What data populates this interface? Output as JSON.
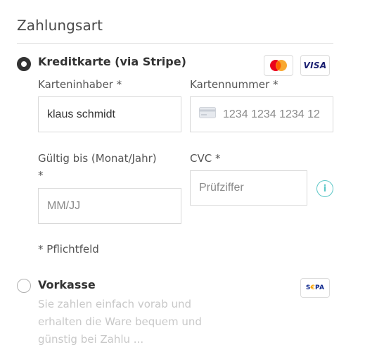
{
  "section_title": "Zahlungsart",
  "methods": {
    "credit_card": {
      "title": "Kreditkarte (via Stripe)",
      "selected": true,
      "badges": [
        "mastercard-icon",
        "visa-icon"
      ],
      "visa_label": "VISA",
      "fields": {
        "holder": {
          "label": "Karteninhaber *",
          "value": "klaus schmidt"
        },
        "number": {
          "label": "Kartennummer *",
          "placeholder": "1234 1234 1234 12"
        },
        "expiry": {
          "label_line1": "Gültig bis (Monat/Jahr)",
          "label_line2": "*",
          "placeholder": "MM/JJ"
        },
        "cvc": {
          "label": "CVC *",
          "placeholder": "Prüfziffer"
        }
      },
      "required_note": "* Pflichtfeld"
    },
    "prepayment": {
      "title": "Vorkasse",
      "selected": false,
      "sepa_s": "S",
      "sepa_e": "€",
      "sepa_rest": "PA",
      "description_lines": [
        "Sie zahlen einfach vorab und",
        "erhalten die Ware bequem und",
        "günstig bei Zahlu ..."
      ]
    }
  },
  "colors": {
    "info_accent": "#5cc7c7",
    "mastercard_red": "#eb001b",
    "mastercard_orange": "#f79e1b",
    "visa_blue": "#1a1f71",
    "sepa_blue": "#10298e"
  }
}
